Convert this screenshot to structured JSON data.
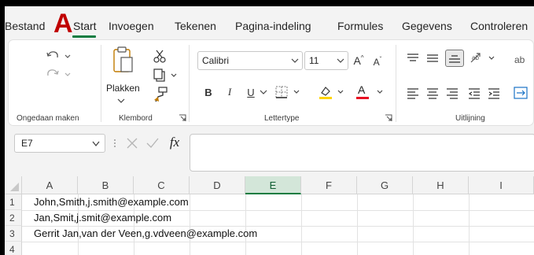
{
  "menu": {
    "tabs": [
      "Bestand",
      "Start",
      "Invoegen",
      "Tekenen",
      "Pagina-indeling",
      "Formules",
      "Gegevens",
      "Controleren"
    ],
    "active_tab": "Start",
    "overlay_letter": "A"
  },
  "ribbon": {
    "groups": {
      "undo": "Ongedaan maken",
      "clipboard": "Klembord",
      "font": "Lettertype",
      "alignment": "Uitlijning"
    },
    "paste_label": "Plakken",
    "font_name": "Calibri",
    "font_size": "11",
    "bold_label": "B",
    "italic_label": "I",
    "underline_label": "U",
    "increase_font_label": "A",
    "decrease_font_label": "A",
    "font_color_label": "A",
    "wrap_partial_label": "ab"
  },
  "formula_bar": {
    "name_box": "E7",
    "fx_label": "fx",
    "formula_value": ""
  },
  "sheet": {
    "columns": [
      "A",
      "B",
      "C",
      "D",
      "E",
      "F",
      "G",
      "H",
      "I"
    ],
    "selected_column": "E",
    "rows": [
      {
        "num": "1",
        "a": "John,Smith,j.smith@example.com"
      },
      {
        "num": "2",
        "a": "Jan,Smit,j.smit@example.com"
      },
      {
        "num": "3",
        "a": "Gerrit Jan,van der Veen,g.vdveen@example.com"
      },
      {
        "num": "4",
        "a": ""
      }
    ]
  },
  "colors": {
    "accent": "#107c41",
    "highlight_yellow": "#ffd400",
    "font_red": "#e81123",
    "overlay_red": "#c00000"
  },
  "icons": [
    "undo-icon",
    "redo-icon",
    "paste-icon",
    "cut-icon",
    "copy-icon",
    "format-painter-icon",
    "borders-icon",
    "fill-color-icon",
    "align-top-icon",
    "align-middle-icon",
    "align-bottom-icon",
    "orientation-icon",
    "align-left-icon",
    "align-center-icon",
    "align-right-icon",
    "decrease-indent-icon",
    "increase-indent-icon",
    "wrap-text-icon",
    "cancel-icon",
    "enter-icon"
  ]
}
